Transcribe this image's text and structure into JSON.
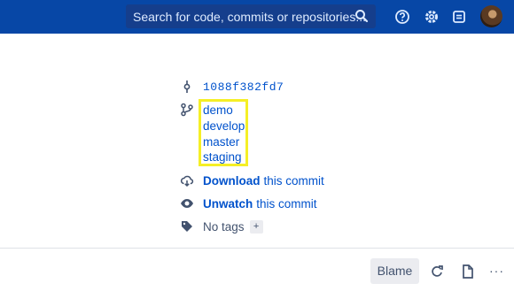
{
  "header": {
    "search_placeholder": "Search for code, commits or repositories...",
    "icons": [
      "search-icon",
      "help-icon",
      "settings-icon",
      "inbox-icon",
      "avatar"
    ]
  },
  "commit": {
    "hash": "1088f382fd7",
    "branches": [
      "demo",
      "develop",
      "master",
      "staging"
    ],
    "download_strong": "Download",
    "download_rest": "this commit",
    "unwatch_strong": "Unwatch",
    "unwatch_rest": "this commit",
    "tags_text": "No tags",
    "add_tag": "+"
  },
  "footer": {
    "blame_label": "Blame",
    "more_label": "···"
  },
  "colors": {
    "header_bg": "#0747a6",
    "link": "#0052cc",
    "highlight": "#f5ef26"
  }
}
